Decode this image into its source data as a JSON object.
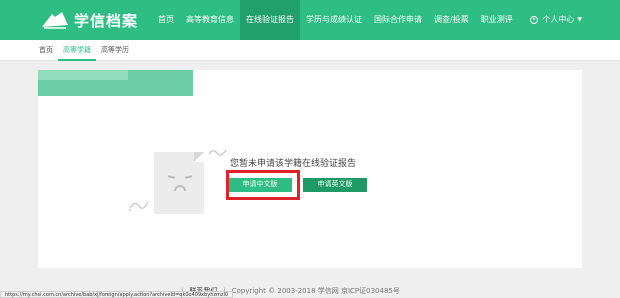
{
  "header": {
    "logo_text": "学信档案",
    "nav": [
      {
        "label": "首页",
        "active": false
      },
      {
        "label": "高等教育信息",
        "active": false
      },
      {
        "label": "在线验证报告",
        "active": true
      },
      {
        "label": "学历与成绩认证",
        "active": false
      },
      {
        "label": "国际合作申请",
        "active": false
      },
      {
        "label": "调查/投票",
        "active": false
      },
      {
        "label": "职业测评",
        "active": false
      }
    ],
    "user_menu": "个人中心",
    "user_caret": "▼"
  },
  "subnav": [
    {
      "label": "首页",
      "active": false
    },
    {
      "label": "高等学籍",
      "active": true
    },
    {
      "label": "高等学历",
      "active": false
    }
  ],
  "main": {
    "message": "您暂未申请该学籍在线验证报告",
    "apply_chinese_label": "申请中文版",
    "apply_english_label": "申请英文版"
  },
  "footer": {
    "contact": "联系我们",
    "separator": "|",
    "copyright": "Copyright © 2003-2018 学信网 京ICP证030485号"
  },
  "status_url": "https://my.chsi.com.cn/archive/bab/xj/foreign/apply.action?archiveId=qk0o409xbyhzmzl0",
  "colors": {
    "brand": "#2ebd83",
    "brand_dark": "#1f9a64",
    "highlight": "#e0222b"
  }
}
